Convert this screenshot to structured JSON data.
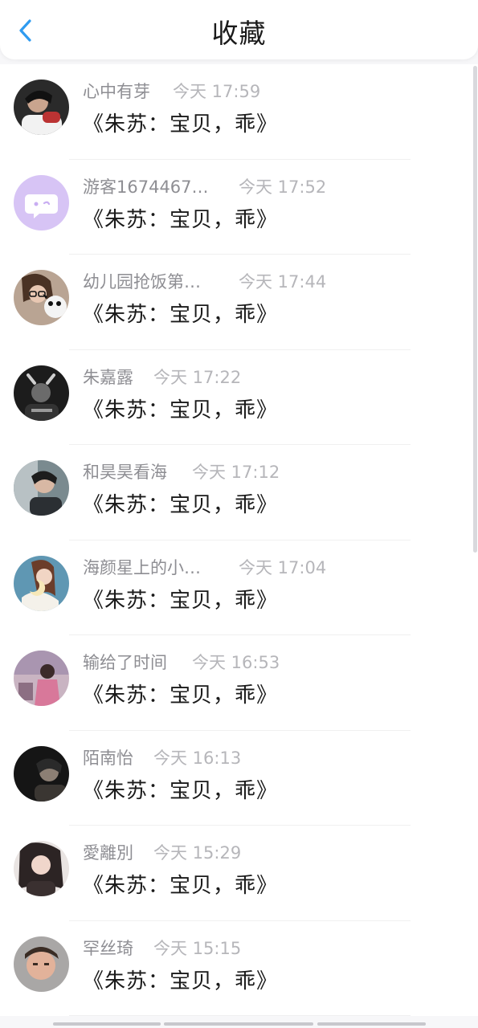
{
  "header": {
    "title": "收藏",
    "back_icon": "chevron-left-icon",
    "accent_color": "#2f9bf0"
  },
  "items": [
    {
      "name": "心中有芽",
      "time": "今天 17:59",
      "message": "《朱苏：宝贝，乖》"
    },
    {
      "name": "游客1674467…",
      "time": "今天 17:52",
      "message": "《朱苏：宝贝，乖》"
    },
    {
      "name": "幼儿园抢饭第…",
      "time": "今天 17:44",
      "message": "《朱苏：宝贝，乖》"
    },
    {
      "name": "朱嘉露",
      "time": "今天 17:22",
      "message": "《朱苏：宝贝，乖》"
    },
    {
      "name": "和昊昊看海",
      "time": "今天 17:12",
      "message": "《朱苏：宝贝，乖》"
    },
    {
      "name": "海颜星上的小…",
      "time": "今天 17:04",
      "message": "《朱苏：宝贝，乖》"
    },
    {
      "name": "输给了时间",
      "time": "今天 16:53",
      "message": "《朱苏：宝贝，乖》"
    },
    {
      "name": "陌南怡",
      "time": "今天 16:13",
      "message": "《朱苏：宝贝，乖》"
    },
    {
      "name": "愛離別",
      "time": "今天 15:29",
      "message": "《朱苏：宝贝，乖》"
    },
    {
      "name": "罕丝琦",
      "time": "今天 15:15",
      "message": "《朱苏：宝贝，乖》"
    }
  ]
}
